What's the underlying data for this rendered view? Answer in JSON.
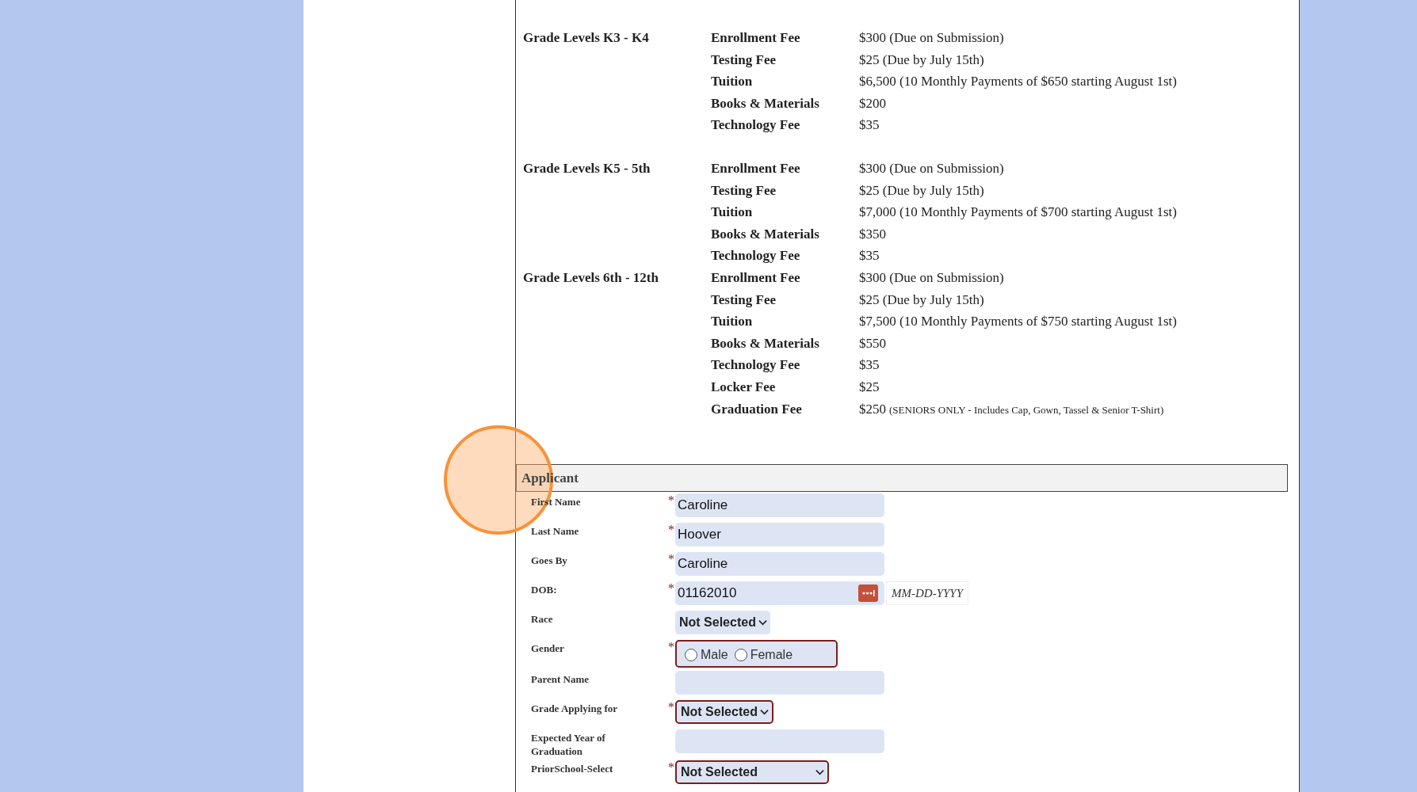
{
  "fee_schedule": [
    {
      "grade_level": "Grade Levels K3 - K4",
      "fees": [
        {
          "name": "Enrollment Fee",
          "amount": "$300 (Due on Submission)"
        },
        {
          "name": "Testing Fee",
          "amount": "$25 (Due by July 15th)"
        },
        {
          "name": "Tuition",
          "amount": "$6,500 (10 Monthly Payments of $650 starting August 1st)"
        },
        {
          "name": "Books & Materials",
          "amount": "$200"
        },
        {
          "name": "Technology Fee",
          "amount": "$35"
        }
      ]
    },
    {
      "grade_level": "Grade Levels K5 - 5th",
      "fees": [
        {
          "name": "Enrollment Fee",
          "amount": "$300 (Due on Submission)"
        },
        {
          "name": "Testing Fee",
          "amount": "$25 (Due by July 15th)"
        },
        {
          "name": "Tuition",
          "amount": "$7,000 (10 Monthly Payments of $700 starting August 1st)"
        },
        {
          "name": "Books & Materials",
          "amount": "$350"
        },
        {
          "name": "Technology Fee",
          "amount": "$35"
        }
      ]
    },
    {
      "grade_level": "Grade Levels 6th - 12th",
      "fees": [
        {
          "name": "Enrollment Fee",
          "amount": "$300 (Due on Submission)"
        },
        {
          "name": "Testing Fee",
          "amount": "$25 (Due by July 15th)"
        },
        {
          "name": "Tuition",
          "amount": "$7,500 (10 Monthly Payments of $750 starting August 1st)"
        },
        {
          "name": "Books & Materials",
          "amount": "$550"
        },
        {
          "name": "Technology Fee",
          "amount": "$35"
        },
        {
          "name": "Locker Fee",
          "amount": "$25"
        },
        {
          "name": "Graduation Fee",
          "amount": "$250",
          "note": "(SENIORS ONLY - Includes Cap, Gown, Tassel & Senior T-Shirt)"
        }
      ]
    }
  ],
  "applicant": {
    "title": "Applicant",
    "fields": [
      {
        "kind": "text",
        "label": "First Name",
        "required_mark": "*",
        "invalid": false,
        "value": "Caroline"
      },
      {
        "kind": "text",
        "label": "Last Name",
        "required_mark": "*",
        "invalid": false,
        "value": "Hoover"
      },
      {
        "kind": "text",
        "label": "Goes By",
        "required_mark": "*",
        "invalid": false,
        "value": "Caroline"
      },
      {
        "kind": "date",
        "label": "DOB:",
        "required_mark": "*",
        "invalid": false,
        "value": "01162010",
        "format_hint": "MM-DD-YYYY"
      },
      {
        "kind": "select",
        "label": "Race",
        "invalid": false,
        "value": "Not Selected"
      },
      {
        "kind": "radio",
        "label": "Gender",
        "required_mark": "*",
        "invalid": true,
        "options": [
          {
            "label": "Male",
            "selected": false
          },
          {
            "label": "Female",
            "selected": false
          }
        ]
      },
      {
        "kind": "text",
        "label": "Parent Name",
        "invalid": false
      },
      {
        "kind": "select",
        "label": "Grade Applying for",
        "required_mark": "*",
        "invalid": true,
        "value": "Not Selected"
      },
      {
        "kind": "text",
        "label": "Expected Year of Graduation",
        "invalid": false
      },
      {
        "kind": "select_wide",
        "label": "PriorSchool-Select",
        "required_mark": "*",
        "invalid": true,
        "value": "Not Selected"
      }
    ]
  }
}
